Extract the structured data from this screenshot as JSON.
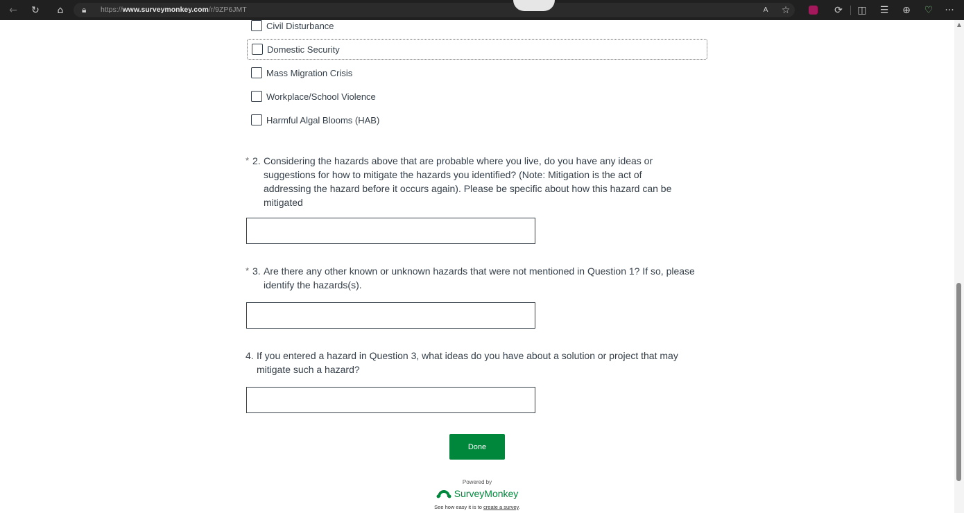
{
  "browser": {
    "url_prefix": "https://",
    "url_domain": "www.surveymonkey.com",
    "url_path": "/r/9ZP6JMT",
    "back_icon": "←",
    "refresh_icon": "↻",
    "home_icon": "⌂",
    "lock_icon": "🔒︎",
    "read_aloud_icon": "A",
    "favorite_icon": "☆",
    "extensions_icon": "⟳",
    "split_icon": "◫",
    "favorites_bar_icon": "☰",
    "collections_icon": "⊕",
    "heart_icon": "♡",
    "more_icon": "···"
  },
  "options": [
    {
      "label": "Civil Disturbance"
    },
    {
      "label": "Domestic Security"
    },
    {
      "label": "Mass Migration Crisis"
    },
    {
      "label": "Workplace/School Violence"
    },
    {
      "label": "Harmful Algal Blooms (HAB)"
    }
  ],
  "questions": [
    {
      "required": "*",
      "number": "2.",
      "lines": [
        "Considering the hazards above that are probable where you live, do you have any ideas or",
        "suggestions for how to mitigate the hazards you identified? (Note: Mitigation is the act of",
        "addressing the hazard before it occurs again). Please be specific about how this hazard can be",
        "mitigated"
      ],
      "answer": ""
    },
    {
      "required": "*",
      "number": "3.",
      "lines": [
        "Are there any other known or unknown hazards that were not mentioned in Question 1?  If so, please",
        "identify the hazards(s)."
      ],
      "answer": ""
    },
    {
      "required": "",
      "number": "4.",
      "lines": [
        "If you entered a hazard in Question 3, what ideas do you have about a solution or project that may",
        "mitigate such a hazard?"
      ],
      "answer": ""
    }
  ],
  "done_label": "Done",
  "footer": {
    "powered_by": "Powered by",
    "brand": "SurveyMonkey",
    "tagline_prefix": "See how easy it is to ",
    "tagline_link": "create a survey",
    "tagline_suffix": "."
  },
  "colors": {
    "accent": "#00873b",
    "text": "#333e48",
    "toolbar": "#202020"
  }
}
